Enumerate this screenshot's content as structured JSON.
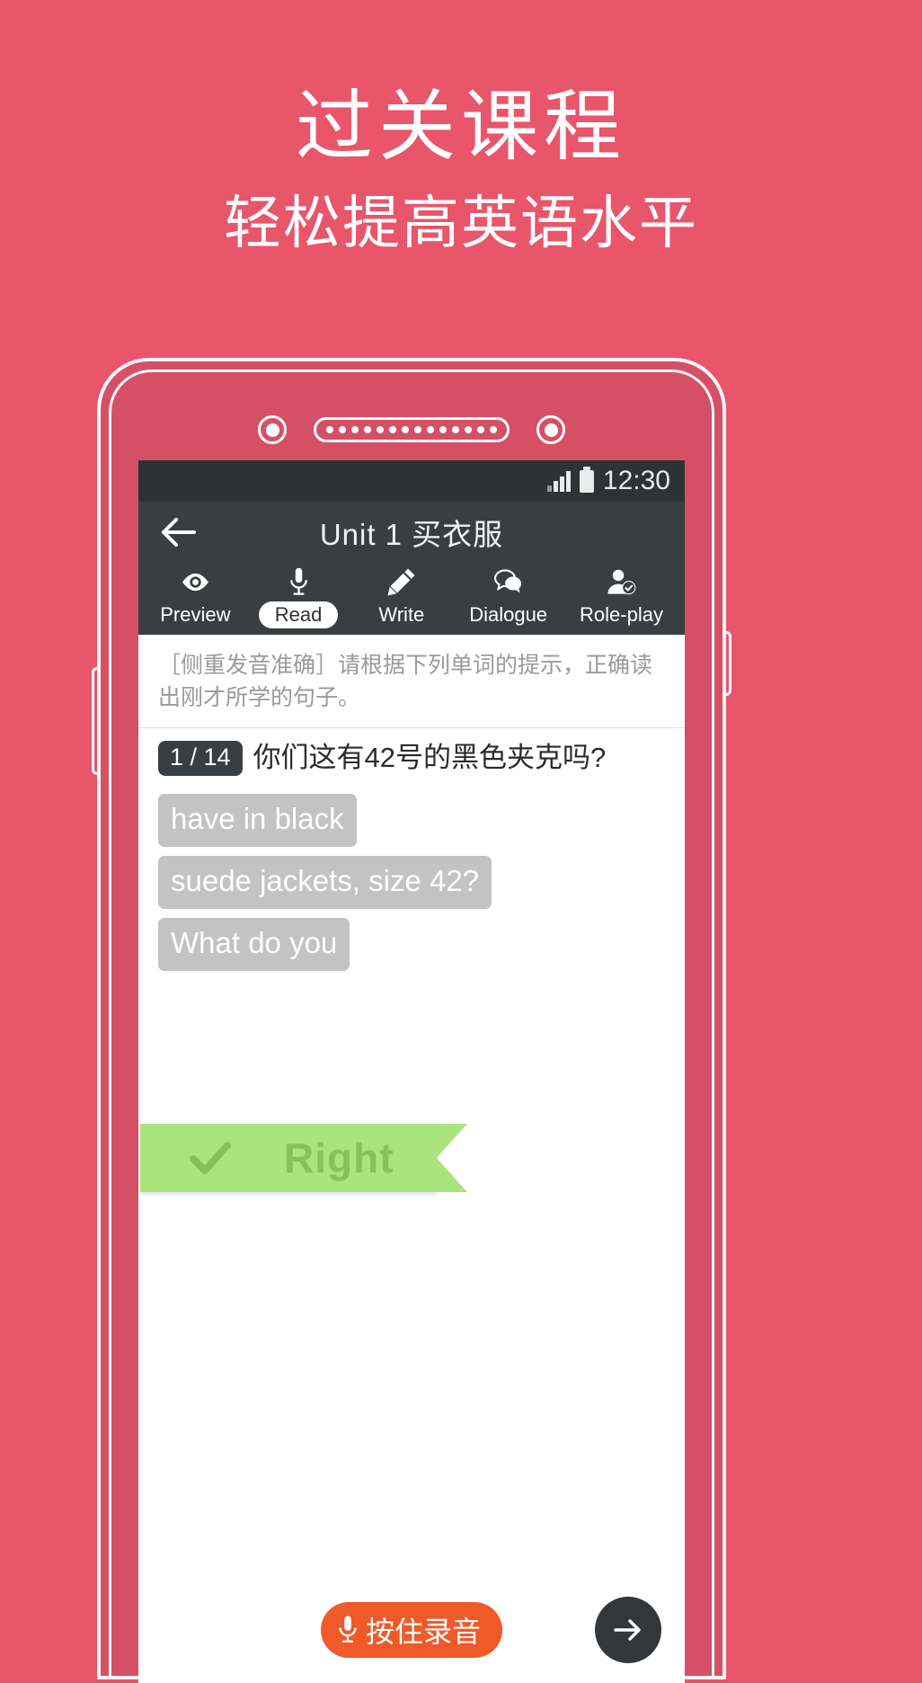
{
  "promo": {
    "title": "过关课程",
    "subtitle": "轻松提高英语水平"
  },
  "colors": {
    "background": "#e9556a",
    "phone_body": "#d65065",
    "statusbar": "#2f3234",
    "titlebar": "#3b3e40",
    "ribbon_green": "#aae47e",
    "ribbon_text": "#87c05d",
    "record_orange": "#f05a28",
    "chip_gray": "#c3c3c3"
  },
  "phone": {
    "camera_icon": "camera-icon",
    "speaker_icon": "speaker-grille-icon",
    "sensor_icon": "sensor-icon"
  },
  "statusbar": {
    "signal_icon": "signal-bars-icon",
    "battery_icon": "battery-icon",
    "time": "12:30"
  },
  "titlebar": {
    "back_icon": "back-arrow-icon",
    "title": "Unit 1 买衣服"
  },
  "tabs": [
    {
      "label": "Preview",
      "icon": "eye-icon",
      "active": false
    },
    {
      "label": "Read",
      "icon": "microphone-icon",
      "active": true
    },
    {
      "label": "Write",
      "icon": "pencil-icon",
      "active": false
    },
    {
      "label": "Dialogue",
      "icon": "speech-bubbles-icon",
      "active": false
    },
    {
      "label": "Role-play",
      "icon": "person-check-icon",
      "active": false
    }
  ],
  "content": {
    "instruction": "［侧重发音准确］请根据下列单词的提示，正确读出刚才所学的句子。",
    "question_badge": "1 / 14",
    "question_text": "你们这有42号的黑色夹克吗?",
    "chips": [
      "have in black",
      "suede jackets, size 42?",
      "What do you"
    ],
    "result": {
      "label": "Right",
      "check_icon": "check-icon"
    }
  },
  "bottombar": {
    "record_label": "按住录音",
    "record_icon": "microphone-icon",
    "next_icon": "arrow-right-icon"
  }
}
